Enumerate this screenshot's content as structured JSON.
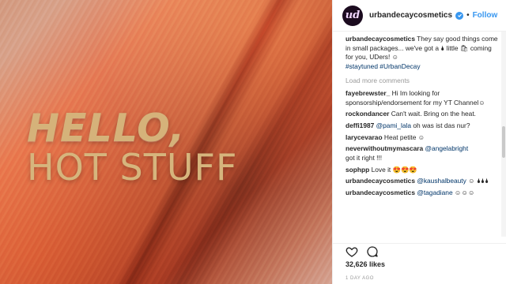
{
  "post": {
    "image_headline_line1": "HELLO,",
    "image_headline_line2": "HOT STUFF"
  },
  "header": {
    "username": "urbandecaycosmetics",
    "avatar_letter": "ud",
    "separator": "•",
    "follow_label": "Follow"
  },
  "caption": {
    "username": "urbandecaycosmetics",
    "text": " They say good things come in small packages... we've got a 🌢 little 🛍 coming for you, UDers! ☺",
    "hashtags": "#staytuned #UrbanDecay"
  },
  "load_more_label": "Load more comments",
  "comments": [
    {
      "user": "fayebrewster_",
      "text": " Hi Im looking for sponsorship/endorsement for my YT Channel☺"
    },
    {
      "user": "rockondancer",
      "text": " Can't wait. Bring on the heat."
    },
    {
      "user": "deffi1987",
      "mention": "@pami_lala",
      "text": " oh was ist das nur?"
    },
    {
      "user": "larycevarao",
      "text": " Heat petite ☺"
    },
    {
      "user": "neverwithoutmymascara",
      "mention": "@angelabright",
      "text": " got it right !!!"
    },
    {
      "user": "sophpp",
      "text": " Love it 😍😍😍"
    },
    {
      "user": "urbandecaycosmetics",
      "mention": "@kaushalbeauty",
      "text": " ☺ 🌢🌢🌢"
    },
    {
      "user": "urbandecaycosmetics",
      "mention": "@tagadiane",
      "text": " ☺☺☺"
    }
  ],
  "likes_label": "32,626 likes",
  "age_label": "1 DAY AGO",
  "icons": [
    "heart-icon",
    "comment-icon",
    "verified-badge-icon"
  ],
  "colors": {
    "accent": "#3897f0",
    "mention": "#003569",
    "muted": "#999999"
  }
}
